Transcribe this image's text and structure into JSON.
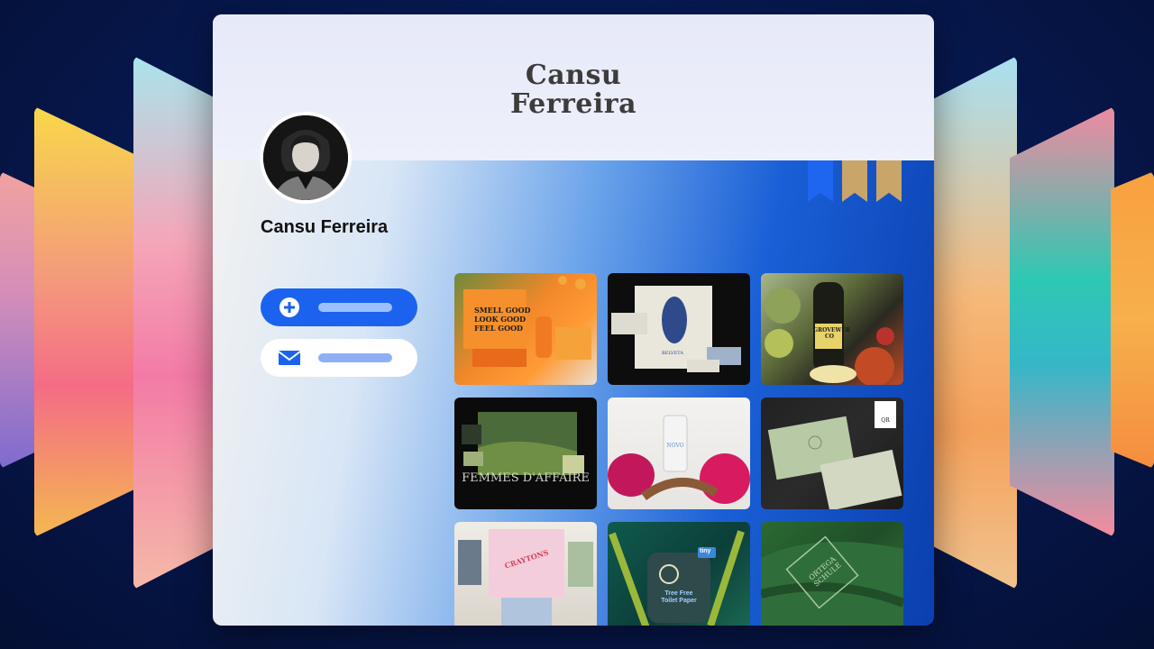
{
  "brand": {
    "line1": "Cansu",
    "line2": "Ferreira"
  },
  "profile": {
    "name": "Cansu Ferreira"
  },
  "actions": [
    {
      "icon": "plus-circle-icon"
    },
    {
      "icon": "envelope-icon"
    }
  ],
  "gallery": {
    "tile1": {
      "line1": "SMELL GOOD",
      "line2": "LOOK GOOD",
      "line3": "FEEL GOOD"
    },
    "tile2": {
      "label": "BELVETA"
    },
    "tile3": {
      "label": "GROVEWER CO"
    },
    "tile4": {
      "label": "FEMMES D'AFFAIRE"
    },
    "tile5": {
      "label": "NOVO"
    },
    "tile6": {
      "label": "QR"
    },
    "tile7": {
      "label": "CRAYTONS"
    },
    "tile8": {
      "line1": "Tree Free",
      "line2": "Toilet Paper",
      "badge": "tiny"
    },
    "tile9": {
      "label": "ORTEGA SCHULE"
    }
  },
  "colors": {
    "accent": "#1b63ee",
    "bookmark_active": "#1e66f0",
    "bookmark_inactive": "#c9a56a"
  }
}
